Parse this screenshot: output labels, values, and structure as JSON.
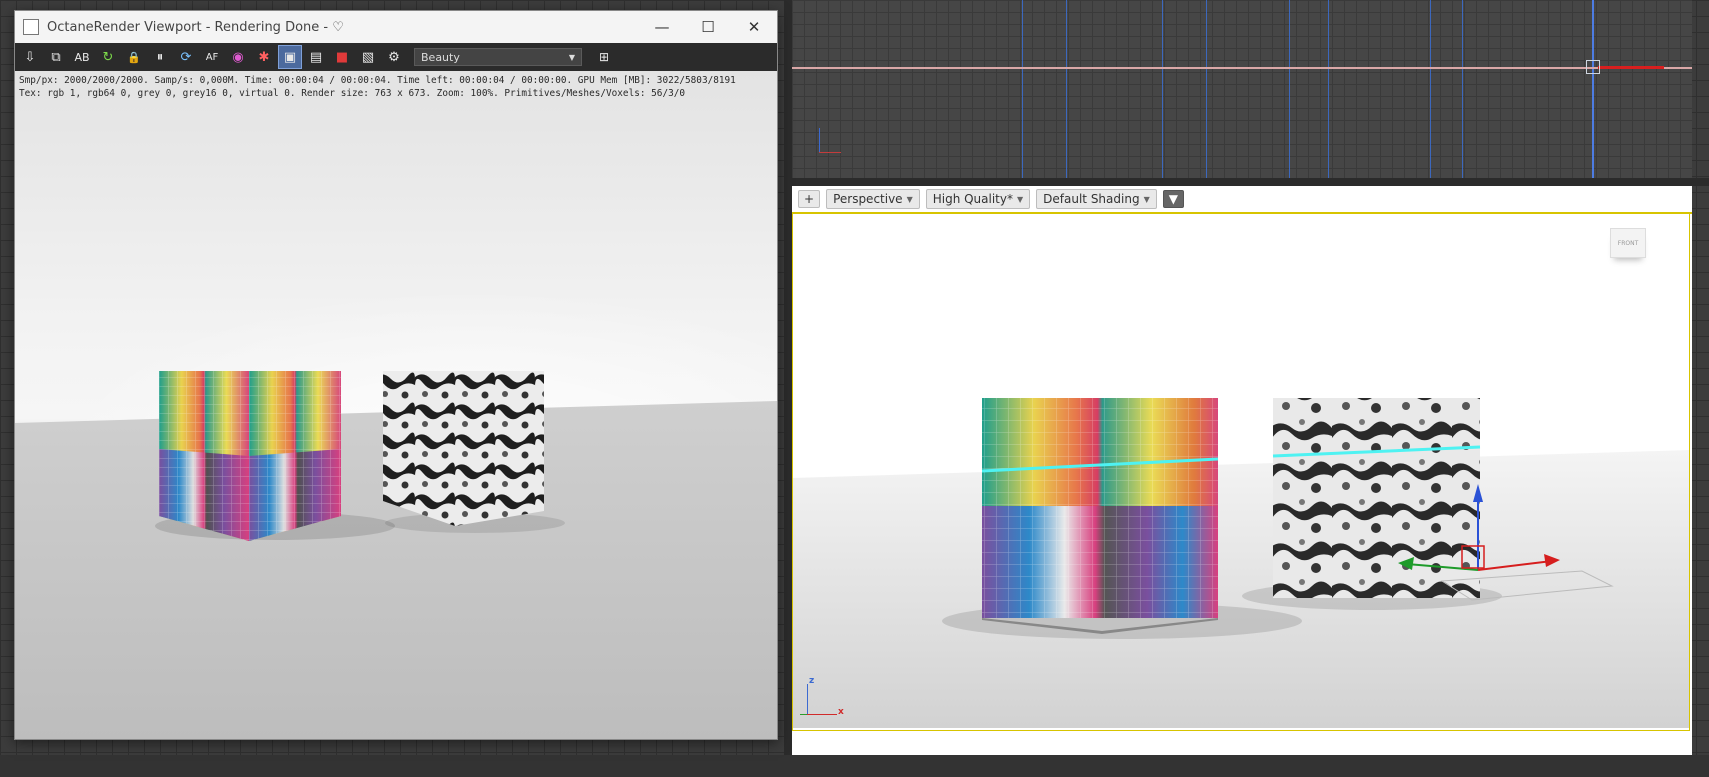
{
  "octane_window": {
    "title": "OctaneRender Viewport - Rendering Done - ♡",
    "controls": {
      "minimize": "—",
      "maximize": "☐",
      "close": "✕"
    },
    "toolbar": {
      "icons": [
        "send-to-max-icon",
        "copy-icon",
        "ab-compare-icon",
        "refresh-icon",
        "lock-icon",
        "pause-icon",
        "restart-icon",
        "af-icon",
        "color-picker-icon",
        "region-icon",
        "display-icon",
        "film-icon",
        "region-render-icon",
        "save-icon",
        "settings-icon"
      ],
      "glyphs": [
        "⇩",
        "⧉",
        "AB",
        "↻",
        "🔒",
        "⏸",
        "⟳",
        "AF",
        "◉",
        "✱",
        "▣",
        "▤",
        "■",
        "▧",
        "⚙"
      ],
      "pass_select": {
        "value": "Beauty",
        "options": [
          "Beauty"
        ]
      },
      "extra_glyph": "⊞"
    },
    "info": {
      "line1": "Smp/px: 2000/2000/2000.   Samp/s: 0,000M.   Time: 00:00:04 / 00:00:04.   Time left: 00:00:04 / 00:00:00.   GPU Mem [MB]: 3022/5803/8191",
      "line2": "Tex: rgb 1, rgb64 0, grey 0, grey16 0, virtual 0.   Render size: 763 x 673.   Zoom: 100%.   Primitives/Meshes/Voxels: 56/3/0"
    }
  },
  "perspective_viewport": {
    "plus_label": "+",
    "view_label": "Perspective",
    "quality_label": "High Quality*",
    "shading_label": "Default Shading",
    "filter_glyph": "▼",
    "viewcube_label": "FRONT",
    "axis_labels": {
      "z": "z",
      "x": "x"
    }
  },
  "top_viewport": {},
  "colors": {
    "accent_yellow": "#d7c400",
    "axis_x": "#d02a2a",
    "axis_y": "#2a9d2a",
    "axis_z": "#3c6ad1"
  }
}
